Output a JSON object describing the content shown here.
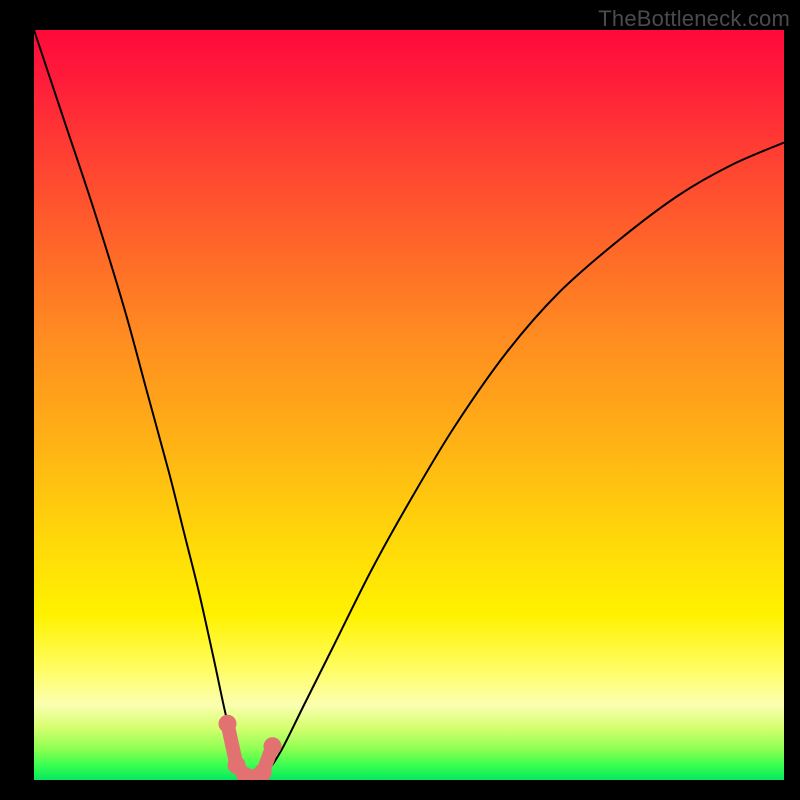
{
  "watermark": "TheBottleneck.com",
  "chart_data": {
    "type": "line",
    "title": "",
    "xlabel": "",
    "ylabel": "",
    "xlim": [
      0,
      100
    ],
    "ylim": [
      0,
      100
    ],
    "background_gradient": {
      "top_color": "#ff0a3a",
      "bottom_color": "#05e860",
      "meaning": "red = high bottleneck, green = low bottleneck"
    },
    "series": [
      {
        "name": "bottleneck-curve",
        "x": [
          0,
          4,
          8,
          12,
          15,
          18,
          20,
          22,
          24,
          25.5,
          27,
          28,
          29,
          30,
          31,
          33,
          36,
          40,
          45,
          50,
          56,
          63,
          70,
          78,
          86,
          93,
          100
        ],
        "y": [
          100,
          88,
          76,
          63,
          52,
          41,
          33,
          25,
          16,
          9,
          3,
          1,
          0.5,
          0.5,
          1,
          4,
          10,
          18,
          28,
          37,
          47,
          57,
          65,
          72,
          78,
          82,
          85
        ]
      }
    ],
    "markers": {
      "name": "optimal-region",
      "x": [
        25.8,
        27.0,
        28.2,
        29.5,
        30.5,
        31.8
      ],
      "y": [
        7.5,
        2.0,
        0.5,
        0.3,
        1.0,
        4.5
      ]
    },
    "grid": false,
    "legend": false
  },
  "colors": {
    "frame": "#000000",
    "curve": "#000000",
    "marker": "#e27272",
    "watermark": "#4b4b4b"
  }
}
